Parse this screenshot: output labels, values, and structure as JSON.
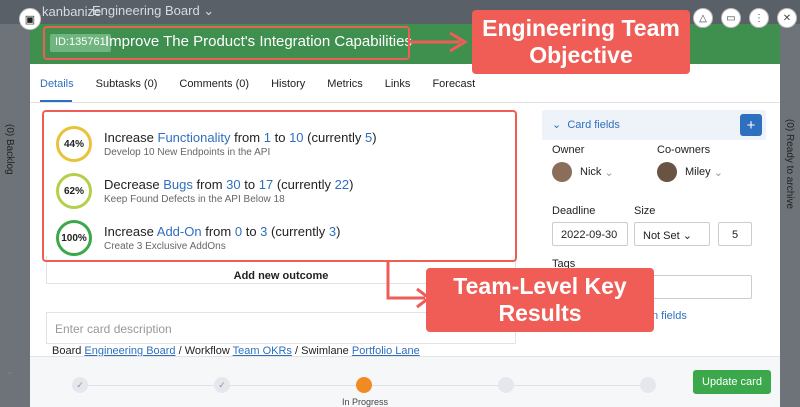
{
  "app": {
    "brand": "kanbanize",
    "board_selector": "Engineering Board ⌄"
  },
  "background": {
    "left_column": "(0) Backlog",
    "right_column": "(0) Ready to archive"
  },
  "card": {
    "id": "ID:135761",
    "title": "Improve The Product's Integration Capabilities",
    "header_color": "#3f8f4f"
  },
  "tabs": [
    {
      "label": "Details",
      "active": true
    },
    {
      "label": "Subtasks (0)"
    },
    {
      "label": "Comments (0)"
    },
    {
      "label": "History"
    },
    {
      "label": "Metrics"
    },
    {
      "label": "Links"
    },
    {
      "label": "Forecast"
    }
  ],
  "key_results": [
    {
      "progress": "44%",
      "progress_color": "#e8c33a",
      "verb": "Increase",
      "metric": "Functionality",
      "from_word": "from",
      "from": "1",
      "to_word": "to",
      "to": "10",
      "current_prefix": "(currently",
      "current": "5",
      "current_suffix": ")",
      "subtitle": "Develop 10 New Endpoints in the API"
    },
    {
      "progress": "62%",
      "progress_color": "#b3cf4c",
      "verb": "Decrease",
      "metric": "Bugs",
      "from_word": "from",
      "from": "30",
      "to_word": "to",
      "to": "17",
      "current_prefix": "(currently",
      "current": "22",
      "current_suffix": ")",
      "subtitle": "Keep Found Defects in the API Below 18"
    },
    {
      "progress": "100%",
      "progress_color": "#3aa84b",
      "verb": "Increase",
      "metric": "Add-On",
      "from_word": "from",
      "from": "0",
      "to_word": "to",
      "to": "3",
      "current_prefix": "(currently",
      "current": "3",
      "current_suffix": ")",
      "subtitle": "Create 3 Exclusive AddOns"
    }
  ],
  "add_outcome_label": "Add new outcome",
  "description_placeholder": "Enter card description",
  "path": {
    "board_label": "Board",
    "board": "Engineering Board",
    "sep1": "/",
    "workflow_label": "Workflow",
    "workflow": "Team OKRs",
    "sep2": "/",
    "swimlane_label": "Swimlane",
    "swimlane": "Portfolio Lane"
  },
  "fields": {
    "panel_label": "Card fields",
    "plus": "+",
    "owner_label": "Owner",
    "owner": "Nick",
    "coowners_label": "Co-owners",
    "coowner": "Miley",
    "deadline_label": "Deadline",
    "deadline": "2022-09-30",
    "size_label": "Size",
    "size": "Not Set",
    "size_value": "5",
    "tags_label": "Tags",
    "more_link": "n fields"
  },
  "workflow_stage": "In Progress",
  "update_button": "Update card",
  "annotations": {
    "objective": "Engineering Team Objective",
    "key_results": "Team-Level Key Results"
  },
  "icons": {
    "check": "✓",
    "chevron": "⌄",
    "close": "✕",
    "more": "⋮",
    "warn": "△"
  }
}
